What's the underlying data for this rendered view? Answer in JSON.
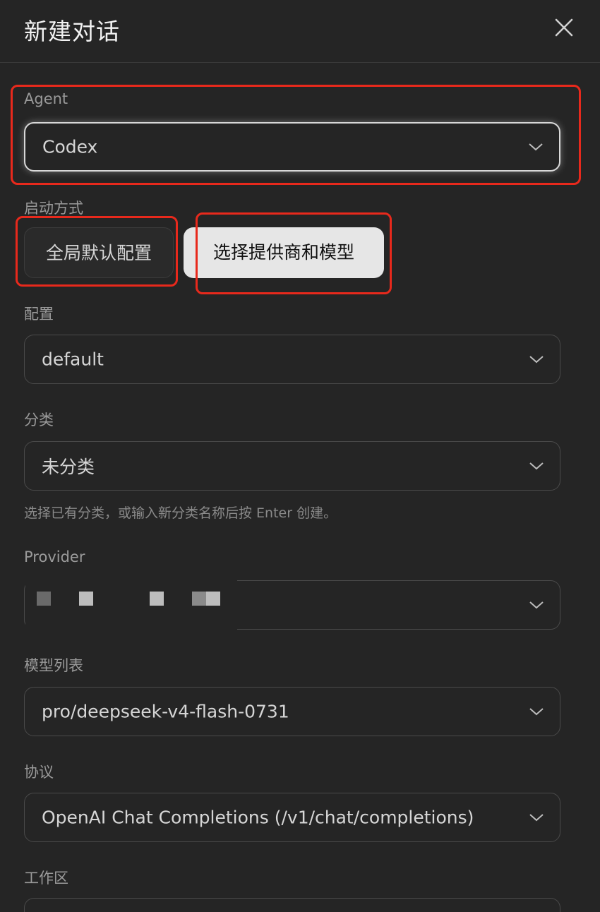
{
  "header": {
    "title": "新建对话"
  },
  "agent": {
    "label": "Agent",
    "value": "Codex"
  },
  "launch_mode": {
    "label": "启动方式",
    "options": [
      "全局默认配置",
      "选择提供商和模型"
    ],
    "selected": "选择提供商和模型"
  },
  "config": {
    "label": "配置",
    "value": "default"
  },
  "category": {
    "label": "分类",
    "value": "未分类",
    "hint": "选择已有分类，或输入新分类名称后按 Enter 创建。"
  },
  "provider": {
    "label": "Provider"
  },
  "model_list": {
    "label": "模型列表",
    "value": "pro/deepseek-v4-flash-0731"
  },
  "protocol": {
    "label": "协议",
    "value": "OpenAI Chat Completions (/v1/chat/completions)"
  },
  "workspace": {
    "label": "工作区"
  },
  "colors": {
    "background": "#252525",
    "annotation_red": "#e8291c",
    "selected_segment": "#e6e6e6"
  },
  "icons": {
    "close": "close-icon",
    "chevron": "chevron-down-icon"
  }
}
